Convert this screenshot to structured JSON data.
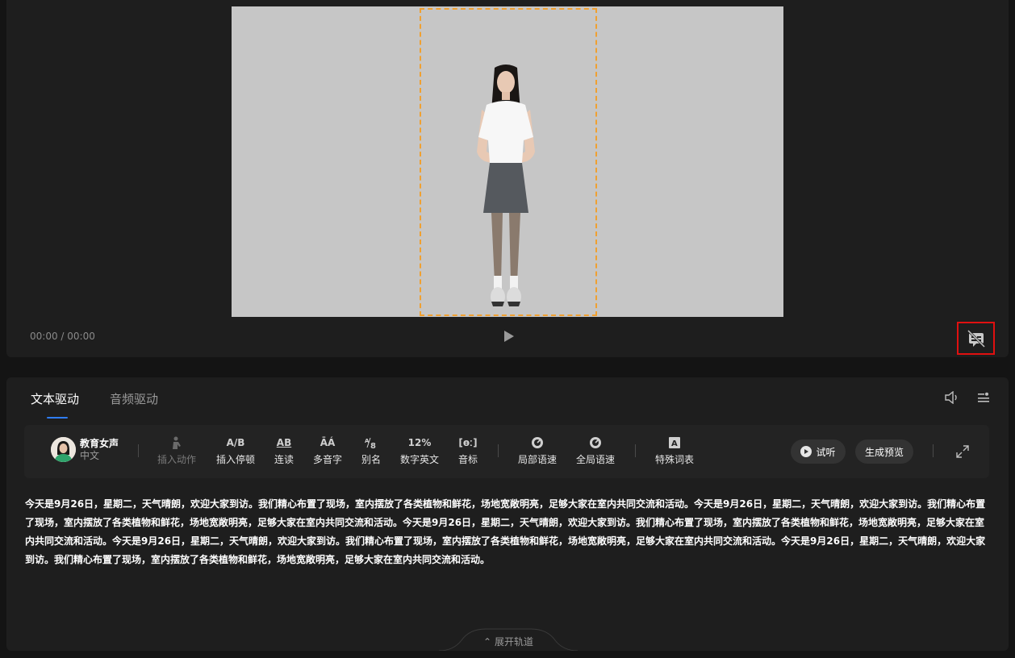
{
  "player": {
    "time": "00:00 / 00:00"
  },
  "tabs": [
    {
      "label": "文本驱动",
      "active": true
    },
    {
      "label": "音频驱动",
      "active": false
    }
  ],
  "voice": {
    "name": "教育女声",
    "language": "中文"
  },
  "toolbar": {
    "insert_action": "插入动作",
    "insert_pause": "插入停顿",
    "liaison": "连读",
    "polyphone": "多音字",
    "alias": "别名",
    "number_english": "数字英文",
    "phonetic": "音标",
    "local_speed": "局部语速",
    "global_speed": "全局语速",
    "special_terms": "特殊词表",
    "audition": "试听",
    "generate_preview": "生成预览"
  },
  "script": {
    "text": "今天是9月26日，星期二，天气晴朗，欢迎大家到访。我们精心布置了现场，室内摆放了各类植物和鲜花，场地宽敞明亮，足够大家在室内共同交流和活动。今天是9月26日，星期二，天气晴朗，欢迎大家到访。我们精心布置了现场，室内摆放了各类植物和鲜花，场地宽敞明亮，足够大家在室内共同交流和活动。今天是9月26日，星期二，天气晴朗，欢迎大家到访。我们精心布置了现场，室内摆放了各类植物和鲜花，场地宽敞明亮，足够大家在室内共同交流和活动。今天是9月26日，星期二，天气晴朗，欢迎大家到访。我们精心布置了现场，室内摆放了各类植物和鲜花，场地宽敞明亮，足够大家在室内共同交流和活动。今天是9月26日，星期二，天气晴朗，欢迎大家到访。我们精心布置了现场，室内摆放了各类植物和鲜花，场地宽敞明亮，足够大家在室内共同交流和活动。"
  },
  "track": {
    "label": "展开轨道"
  },
  "colors": {
    "accent": "#2f7df6",
    "safe_frame": "#f0a030",
    "highlight_box": "#e01010"
  }
}
